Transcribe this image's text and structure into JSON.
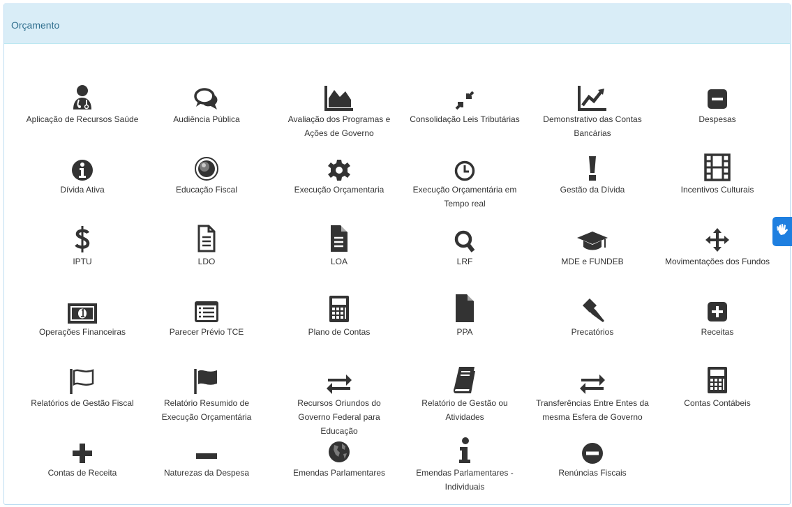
{
  "panel": {
    "title": "Orçamento"
  },
  "items": [
    {
      "label": "Aplicação de Recursos Saúde",
      "icon": "doctor-icon"
    },
    {
      "label": "Audiência Pública",
      "icon": "comments-icon"
    },
    {
      "label": "Avaliação dos Programas e Ações de Governo",
      "icon": "area-chart-icon"
    },
    {
      "label": "Consolidação Leis Tributárias",
      "icon": "compress-icon"
    },
    {
      "label": "Demonstrativo das Contas Bancárias",
      "icon": "line-chart-icon"
    },
    {
      "label": "Despesas",
      "icon": "minus-square-icon"
    },
    {
      "label": "Dívida Ativa",
      "icon": "info-circle-icon"
    },
    {
      "label": "Educação Fiscal",
      "icon": "eye-ring-icon"
    },
    {
      "label": "Execução Orçamentaria",
      "icon": "gear-icon"
    },
    {
      "label": "Execução Orçamentária em Tempo real",
      "icon": "clock-icon"
    },
    {
      "label": "Gestão da Dívida",
      "icon": "exclamation-icon"
    },
    {
      "label": "Incentivos Culturais",
      "icon": "film-icon"
    },
    {
      "label": "IPTU",
      "icon": "dollar-icon"
    },
    {
      "label": "LDO",
      "icon": "file-text-outline-icon"
    },
    {
      "label": "LOA",
      "icon": "file-text-icon"
    },
    {
      "label": "LRF",
      "icon": "search-icon"
    },
    {
      "label": "MDE e FUNDEB",
      "icon": "graduation-cap-icon"
    },
    {
      "label": "Movimentações dos Fundos",
      "icon": "arrows-move-icon"
    },
    {
      "label": "Operações Financeiras",
      "icon": "money-icon"
    },
    {
      "label": "Parecer Prévio TCE",
      "icon": "list-alt-icon"
    },
    {
      "label": "Plano de Contas",
      "icon": "calculator-icon"
    },
    {
      "label": "PPA",
      "icon": "file-icon"
    },
    {
      "label": "Precatórios",
      "icon": "gavel-icon"
    },
    {
      "label": "Receitas",
      "icon": "plus-square-icon"
    },
    {
      "label": "Relatórios de Gestão Fiscal",
      "icon": "flag-outline-icon"
    },
    {
      "label": "Relatório Resumido de Execução Orçamentária",
      "icon": "flag-icon"
    },
    {
      "label": "Recursos Oriundos do Governo Federal para Educação",
      "icon": "exchange-icon"
    },
    {
      "label": "Relatório de Gestão ou Atividades",
      "icon": "book-icon"
    },
    {
      "label": "Transferências Entre Entes da mesma Esfera de Governo",
      "icon": "exchange-icon"
    },
    {
      "label": "Contas Contábeis",
      "icon": "calculator-icon"
    },
    {
      "label": "Contas de Receita",
      "icon": "plus-icon"
    },
    {
      "label": "Naturezas da Despesa",
      "icon": "minus-icon"
    },
    {
      "label": "Emendas Parlamentares",
      "icon": "globe-icon"
    },
    {
      "label": "Emendas Parlamentares - Individuais",
      "icon": "info-icon"
    },
    {
      "label": "Renúncias Fiscais",
      "icon": "minus-circle-icon"
    }
  ],
  "accessibility": {
    "icon": "sign-language-icon"
  }
}
